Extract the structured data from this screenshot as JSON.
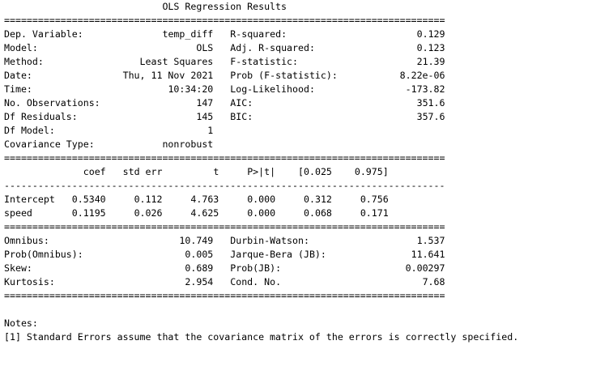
{
  "title": "OLS Regression Results",
  "separator_double": "==============================================================================",
  "separator_single": "------------------------------------------------------------------------------",
  "model_info": [
    {
      "left_label": "Dep. Variable:",
      "left_value": "temp_diff",
      "right_label": "R-squared:",
      "right_value": "0.129"
    },
    {
      "left_label": "Model:",
      "left_value": "OLS",
      "right_label": "Adj. R-squared:",
      "right_value": "0.123"
    },
    {
      "left_label": "Method:",
      "left_value": "Least Squares",
      "right_label": "F-statistic:",
      "right_value": "21.39"
    },
    {
      "left_label": "Date:",
      "left_value": "Thu, 11 Nov 2021",
      "right_label": "Prob (F-statistic):",
      "right_value": "8.22e-06"
    },
    {
      "left_label": "Time:",
      "left_value": "10:34:20",
      "right_label": "Log-Likelihood:",
      "right_value": "-173.82"
    },
    {
      "left_label": "No. Observations:",
      "left_value": "147",
      "right_label": "AIC:",
      "right_value": "351.6"
    },
    {
      "left_label": "Df Residuals:",
      "left_value": "145",
      "right_label": "BIC:",
      "right_value": "357.6"
    },
    {
      "left_label": "Df Model:",
      "left_value": "1",
      "right_label": "",
      "right_value": ""
    },
    {
      "left_label": "Covariance Type:",
      "left_value": "nonrobust",
      "right_label": "",
      "right_value": ""
    }
  ],
  "coef_headers": [
    "coef",
    "std err",
    "t",
    "P>|t|",
    "[0.025",
    "0.975]"
  ],
  "coef_rows": [
    {
      "name": "Intercept",
      "values": [
        "0.5340",
        "0.112",
        "4.763",
        "0.000",
        "0.312",
        "0.756"
      ]
    },
    {
      "name": "speed",
      "values": [
        "0.1195",
        "0.026",
        "4.625",
        "0.000",
        "0.068",
        "0.171"
      ]
    }
  ],
  "diagnostics": [
    {
      "left_label": "Omnibus:",
      "left_value": "10.749",
      "right_label": "Durbin-Watson:",
      "right_value": "1.537"
    },
    {
      "left_label": "Prob(Omnibus):",
      "left_value": "0.005",
      "right_label": "Jarque-Bera (JB):",
      "right_value": "11.641"
    },
    {
      "left_label": "Skew:",
      "left_value": "0.689",
      "right_label": "Prob(JB):",
      "right_value": "0.00297"
    },
    {
      "left_label": "Kurtosis:",
      "left_value": "2.954",
      "right_label": "Cond. No.",
      "right_value": "7.68"
    }
  ],
  "notes_heading": "Notes:",
  "notes": [
    "[1] Standard Errors assume that the covariance matrix of the errors is correctly specified."
  ]
}
